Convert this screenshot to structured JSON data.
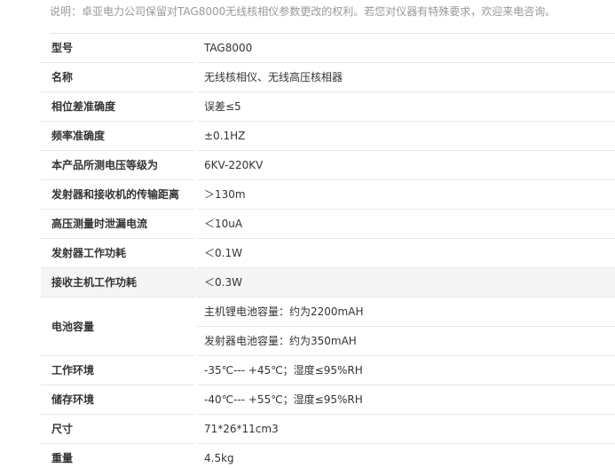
{
  "note": "说明：卓亚电力公司保留对TAG8000无线核相仪参数更改的权利。若您对仪器有特殊要求，欢迎来电咨询。",
  "rows": [
    {
      "label": "型号",
      "value": "TAG8000"
    },
    {
      "label": "名称",
      "value": "无线核相仪、无线高压核相器"
    },
    {
      "label": "相位差准确度",
      "value": "误差≤5"
    },
    {
      "label": "频率准确度",
      "value": "±0.1HZ"
    },
    {
      "label": "本产品所测电压等级为",
      "value": "6KV-220KV"
    },
    {
      "label": "发射器和接收机的传输距离",
      "value": "＞130m"
    },
    {
      "label": "高压测量时泄漏电流",
      "value": "＜10uA"
    },
    {
      "label": "发射器工作功耗",
      "value": "＜0.1W"
    },
    {
      "label": "接收主机工作功耗",
      "value": "＜0.3W"
    },
    {
      "label": "电池容量",
      "values": [
        "主机锂电池容量：约为2200mAH",
        "发射器电池容量：约为350mAH"
      ]
    },
    {
      "label": "工作环境",
      "value": "-35℃--- +45℃；湿度≤95%RH"
    },
    {
      "label": "储存环境",
      "value": "-40℃--- +55℃；湿度≤95%RH"
    },
    {
      "label": "尺寸",
      "value": "71*26*11cm3"
    },
    {
      "label": "重量",
      "value": "4.5kg"
    }
  ]
}
